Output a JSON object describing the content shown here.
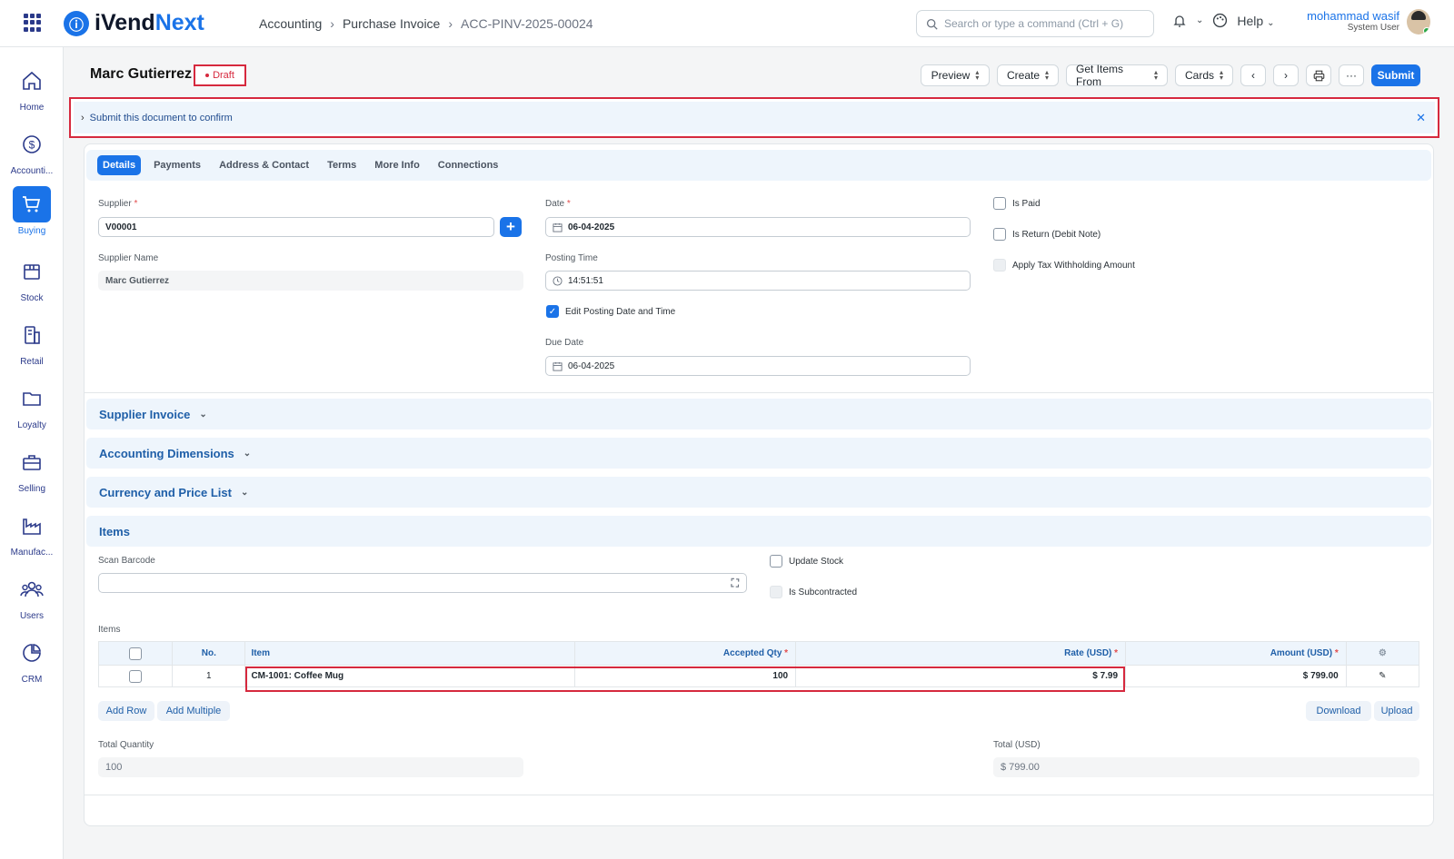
{
  "app": {
    "logo_prefix": "iVend",
    "logo_suffix": "Next"
  },
  "breadcrumb": [
    "Accounting",
    "Purchase Invoice",
    "ACC-PINV-2025-00024"
  ],
  "search": {
    "placeholder": "Search or type a command (Ctrl + G)"
  },
  "topbar": {
    "help": "Help",
    "user_name": "mohammad wasif",
    "user_role": "System User"
  },
  "sidebar": [
    {
      "label": "Home",
      "icon": "home-icon"
    },
    {
      "label": "Accounti...",
      "icon": "dollar-icon"
    },
    {
      "label": "Buying",
      "icon": "cart-icon",
      "active": true
    },
    {
      "label": "Stock",
      "icon": "box-icon"
    },
    {
      "label": "Retail",
      "icon": "pos-icon"
    },
    {
      "label": "Loyalty",
      "icon": "folder-icon"
    },
    {
      "label": "Selling",
      "icon": "briefcase-icon"
    },
    {
      "label": "Manufac...",
      "icon": "factory-icon"
    },
    {
      "label": "Users",
      "icon": "users-icon"
    },
    {
      "label": "CRM",
      "icon": "crm-icon"
    }
  ],
  "page": {
    "title": "Marc Gutierrez",
    "status": "Draft"
  },
  "actions": {
    "preview": "Preview",
    "create": "Create",
    "get_items": "Get Items From",
    "cards": "Cards",
    "submit": "Submit"
  },
  "notice": {
    "text": "Submit this document to confirm"
  },
  "tabs": [
    "Details",
    "Payments",
    "Address & Contact",
    "Terms",
    "More Info",
    "Connections"
  ],
  "form": {
    "supplier_label": "Supplier",
    "supplier": "V00001",
    "supplier_name_label": "Supplier Name",
    "supplier_name": "Marc Gutierrez",
    "date_label": "Date",
    "date": "06-04-2025",
    "posting_time_label": "Posting Time",
    "posting_time": "14:51:51",
    "edit_posting": "Edit Posting Date and Time",
    "due_date_label": "Due Date",
    "due_date": "06-04-2025",
    "is_paid": "Is Paid",
    "is_return": "Is Return (Debit Note)",
    "apply_tax": "Apply Tax Withholding Amount"
  },
  "sections": {
    "supplier_invoice": "Supplier Invoice",
    "accounting_dimensions": "Accounting Dimensions",
    "currency_price": "Currency and Price List",
    "items": "Items"
  },
  "items_section": {
    "scan_barcode": "Scan Barcode",
    "update_stock": "Update Stock",
    "is_subcontracted": "Is Subcontracted",
    "items_label": "Items",
    "columns": [
      "No.",
      "Item",
      "Accepted Qty",
      "Rate (USD)",
      "Amount (USD)"
    ],
    "rows": [
      {
        "no": "1",
        "item": "CM-1001: Coffee Mug",
        "qty": "100",
        "rate": "$ 7.99",
        "amount": "$ 799.00"
      }
    ],
    "add_row": "Add Row",
    "add_multiple": "Add Multiple",
    "download": "Download",
    "upload": "Upload"
  },
  "totals": {
    "qty_label": "Total Quantity",
    "qty": "100",
    "total_label": "Total (USD)",
    "total": "$ 799.00"
  },
  "colors": {
    "accent": "#1a73e8",
    "highlight": "#d6293e"
  }
}
